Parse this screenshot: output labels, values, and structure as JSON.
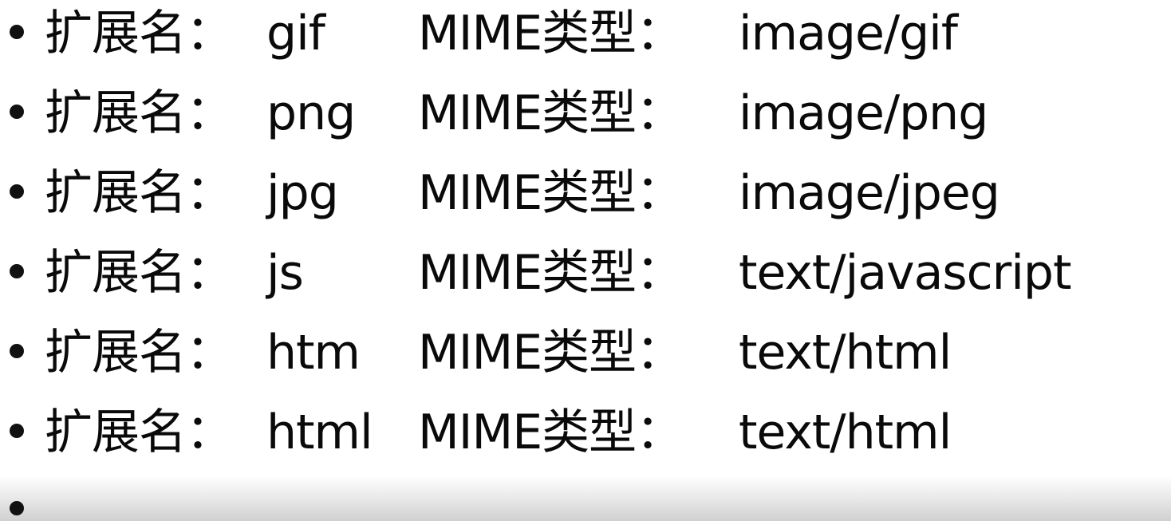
{
  "items": [
    {
      "label": "扩展名：",
      "ext": "gif",
      "mime_label": "MIME类型：",
      "mime": "image/gif"
    },
    {
      "label": "扩展名：",
      "ext": "png",
      "mime_label": "MIME类型：",
      "mime": "image/png"
    },
    {
      "label": "扩展名：",
      "ext": "jpg",
      "mime_label": "MIME类型：",
      "mime": "image/jpeg"
    },
    {
      "label": "扩展名：",
      "ext": "js",
      "mime_label": "MIME类型：",
      "mime": "text/javascript"
    },
    {
      "label": "扩展名：",
      "ext": "htm",
      "mime_label": "MIME类型：",
      "mime": "text/html"
    },
    {
      "label": "扩展名：",
      "ext": "html",
      "mime_label": "MIME类型：",
      "mime": "text/html"
    }
  ]
}
